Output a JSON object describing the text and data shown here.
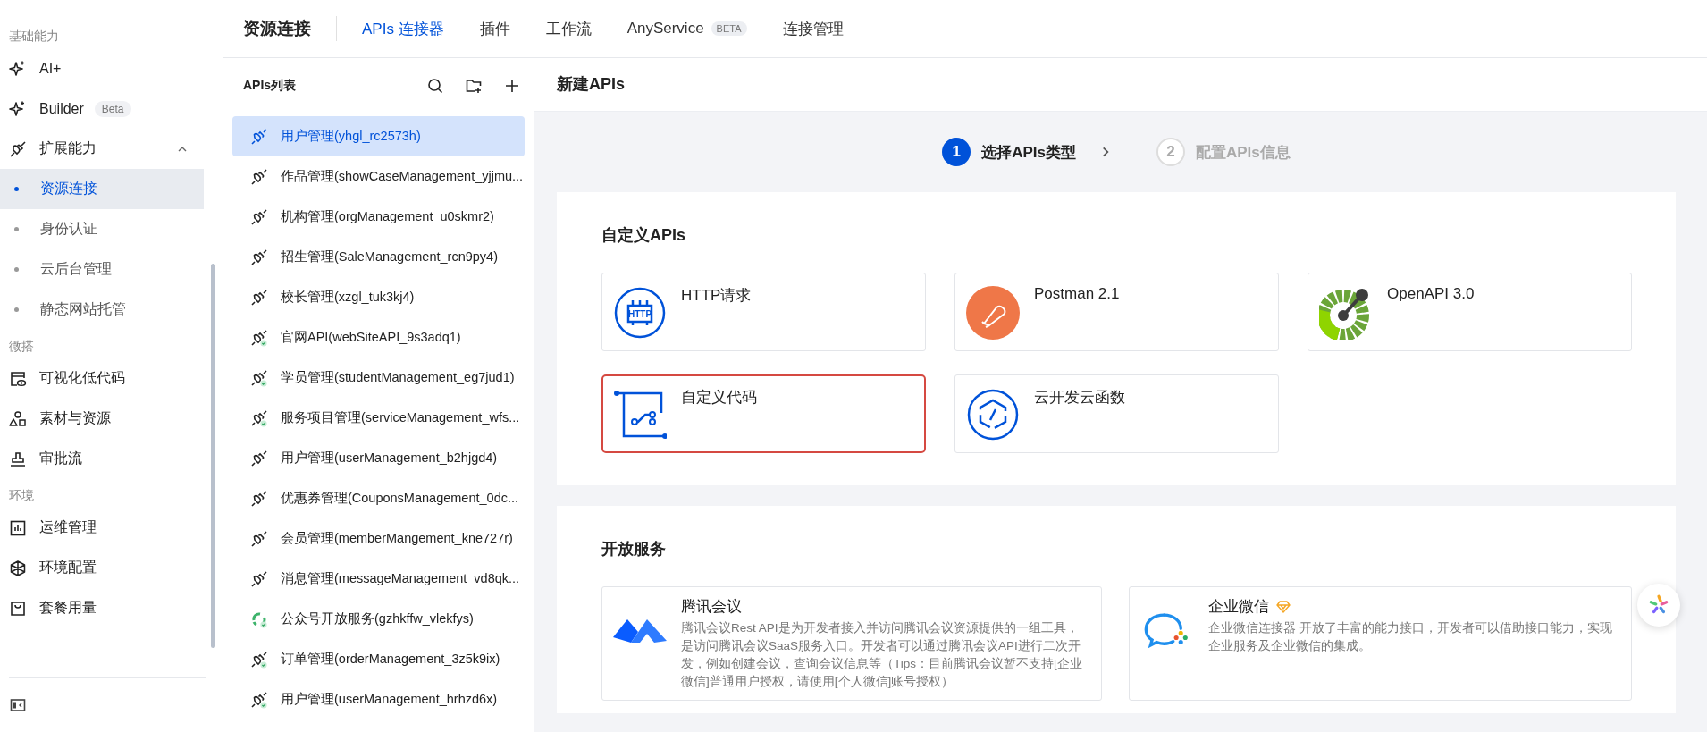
{
  "sidebar": {
    "sections": [
      {
        "label": "基础能力",
        "items": [
          {
            "label": "AI+",
            "kind": "sparkle"
          },
          {
            "label": "Builder",
            "kind": "sparkle",
            "badge": "Beta"
          },
          {
            "label": "扩展能力",
            "kind": "plug",
            "expanded": true,
            "children": [
              {
                "label": "资源连接",
                "selected": true
              },
              {
                "label": "身份认证",
                "selected": false
              },
              {
                "label": "云后台管理",
                "selected": false
              },
              {
                "label": "静态网站托管",
                "selected": false
              }
            ]
          }
        ]
      },
      {
        "label": "微搭",
        "items": [
          {
            "label": "可视化低代码",
            "kind": "page-eye"
          },
          {
            "label": "素材与资源",
            "kind": "shapes"
          },
          {
            "label": "审批流",
            "kind": "stamp"
          }
        ]
      },
      {
        "label": "环境",
        "items": [
          {
            "label": "运维管理",
            "kind": "chart"
          },
          {
            "label": "环境配置",
            "kind": "cube"
          },
          {
            "label": "套餐用量",
            "kind": "bag"
          }
        ]
      }
    ]
  },
  "top_nav": {
    "title": "资源连接",
    "tabs": [
      {
        "label": "APIs 连接器",
        "selected": true
      },
      {
        "label": "插件",
        "selected": false
      },
      {
        "label": "工作流",
        "selected": false
      },
      {
        "label": "AnyService",
        "selected": false,
        "badge": "BETA"
      },
      {
        "label": "连接管理",
        "selected": false
      }
    ]
  },
  "api_list": {
    "title": "APIs列表",
    "items": [
      {
        "label": "用户管理(yhgl_rc2573h)",
        "kind": "link",
        "selected": true
      },
      {
        "label": "作品管理(showCaseManagement_yjjmu...",
        "kind": "link",
        "selected": false
      },
      {
        "label": "机构管理(orgManagement_u0skmr2)",
        "kind": "link",
        "selected": false
      },
      {
        "label": "招生管理(SaleManagement_rcn9py4)",
        "kind": "link",
        "selected": false
      },
      {
        "label": "校长管理(xzgl_tuk3kj4)",
        "kind": "link",
        "selected": false
      },
      {
        "label": "官网API(webSiteAPI_9s3adq1)",
        "kind": "link-check",
        "selected": false
      },
      {
        "label": "学员管理(studentManagement_eg7jud1)",
        "kind": "link-check",
        "selected": false
      },
      {
        "label": "服务项目管理(serviceManagement_wfs...",
        "kind": "link-check",
        "selected": false
      },
      {
        "label": "用户管理(userManagement_b2hjgd4)",
        "kind": "link",
        "selected": false
      },
      {
        "label": "优惠券管理(CouponsManagement_0dc...",
        "kind": "link",
        "selected": false
      },
      {
        "label": "会员管理(memberMangement_kne727r)",
        "kind": "link",
        "selected": false
      },
      {
        "label": "消息管理(messageManagement_vd8qk...",
        "kind": "link",
        "selected": false
      },
      {
        "label": "公众号开放服务(gzhkffw_vlekfys)",
        "kind": "recycle-check",
        "selected": false
      },
      {
        "label": "订单管理(orderManagement_3z5k9ix)",
        "kind": "link-check",
        "selected": false
      },
      {
        "label": "用户管理(userManagement_hrhzd6x)",
        "kind": "link-check",
        "selected": false
      }
    ]
  },
  "main": {
    "title": "新建APIs",
    "steps": [
      {
        "number": "1",
        "label": "选择APIs类型",
        "active": true
      },
      {
        "number": "2",
        "label": "配置APIs信息",
        "active": false
      }
    ],
    "custom_section": {
      "title": "自定义APIs",
      "cards": [
        {
          "label": "HTTP请求",
          "kind": "http",
          "icon_text": "HTTP",
          "selected": false
        },
        {
          "label": "Postman 2.1",
          "kind": "postman",
          "selected": false
        },
        {
          "label": "OpenAPI 3.0",
          "kind": "openapi",
          "selected": false
        },
        {
          "label": "自定义代码",
          "kind": "code",
          "selected": true
        },
        {
          "label": "云开发云函数",
          "kind": "function",
          "selected": false
        }
      ]
    },
    "open_services": {
      "title": "开放服务",
      "cards": [
        {
          "title": "腾讯会议",
          "kind": "meeting",
          "premium": false,
          "description": "腾讯会议Rest API是为开发者接入并访问腾讯会议资源提供的一组工具，是访问腾讯会议SaaS服务入口。开发者可以通过腾讯会议API进行二次开发，例如创建会议，查询会议信息等（Tips：目前腾讯会议暂不支持[企业微信]普通用户授权，请使用[个人微信]账号授权）"
        },
        {
          "title": "企业微信",
          "kind": "wecom",
          "premium": true,
          "description": "企业微信连接器 开放了丰富的能力接口，开发者可以借助接口能力，实现企业服务及企业微信的集成。"
        }
      ]
    }
  }
}
